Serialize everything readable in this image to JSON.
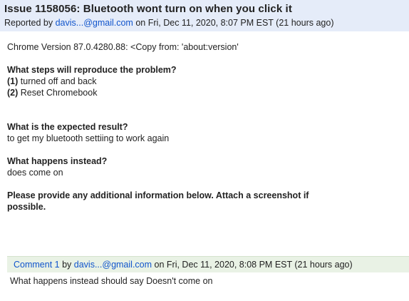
{
  "issue": {
    "title": "Issue 1158056: Bluetooth wont turn on when you click it",
    "reported_by_prefix": "Reported by",
    "reporter": "davis...@gmail.com",
    "reported_on": "on Fri, Dec 11, 2020, 8:07 PM EST (21 hours ago)"
  },
  "body": {
    "chrome_version": "Chrome Version 87.0.4280.88: <Copy from: 'about:version'",
    "steps_heading": "What steps will reproduce the problem?",
    "steps": [
      {
        "num": "(1)",
        "text": "turned off and back"
      },
      {
        "num": "(2)",
        "text": "Reset Chromebook"
      }
    ],
    "expected_heading": "What is the expected result?",
    "expected_text": "to get my bluetooth settiing to work again",
    "instead_heading": "What happens instead?",
    "instead_text": "does come on",
    "additional_heading": "Please provide any additional information below. Attach a screenshot if possible."
  },
  "comment": {
    "link_label": "Comment 1",
    "by": "by",
    "author": "davis...@gmail.com",
    "posted_on": "on Fri, Dec 11, 2020, 8:08 PM EST (21 hours ago)",
    "text": "What happens instead should say Doesn't come on"
  }
}
